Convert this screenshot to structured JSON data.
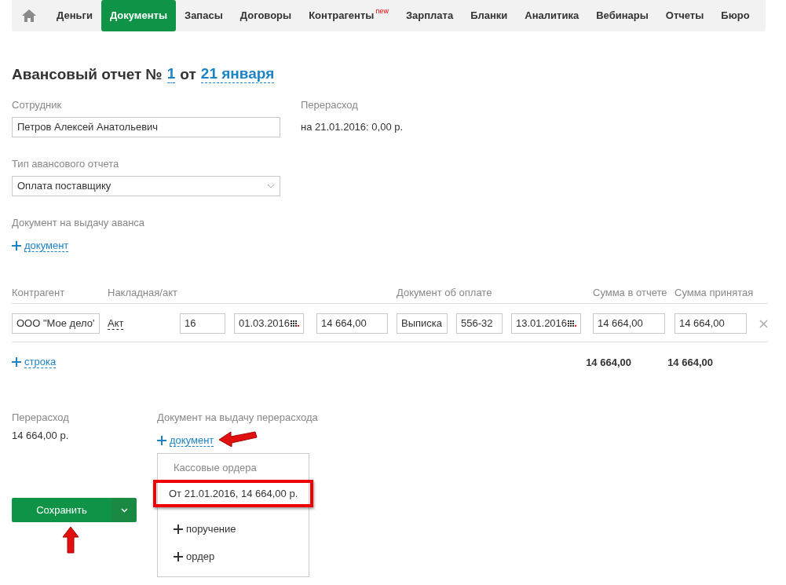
{
  "nav": {
    "items": [
      {
        "label": "Деньги",
        "selected": false
      },
      {
        "label": "Документы",
        "selected": true
      },
      {
        "label": "Запасы",
        "selected": false
      },
      {
        "label": "Договоры",
        "selected": false
      },
      {
        "label": "Контрагенты",
        "selected": false,
        "badge": "new"
      },
      {
        "label": "Зарплата",
        "selected": false
      },
      {
        "label": "Бланки",
        "selected": false
      },
      {
        "label": "Аналитика",
        "selected": false
      },
      {
        "label": "Вебинары",
        "selected": false
      },
      {
        "label": "Отчеты",
        "selected": false
      },
      {
        "label": "Бюро",
        "selected": false
      }
    ]
  },
  "title": {
    "text": "Авансовый отчет №",
    "number": "1",
    "from": "от",
    "date": "21 января"
  },
  "employee": {
    "label": "Сотрудник",
    "value": "Петров Алексей Анатольевич"
  },
  "overspend_top": {
    "label": "Перерасход",
    "value": "на 21.01.2016: 0,00 р."
  },
  "report_type": {
    "label": "Тип авансового отчета",
    "value": "Оплата поставщику"
  },
  "advance_document": {
    "label": "Документ на выдачу аванса",
    "link": "документ"
  },
  "table": {
    "columns": [
      "Контрагент",
      "Накладная/акт",
      "",
      "",
      "",
      "Документ об оплате",
      "",
      "",
      "Сумма в отчете",
      "Сумма принятая"
    ],
    "rows": [
      {
        "cells": [
          {
            "kind": "input",
            "value": "ООО \"Мое дело'"
          },
          {
            "kind": "link",
            "value": "Акт"
          },
          {
            "kind": "input",
            "value": "16"
          },
          {
            "kind": "date",
            "value": "01.03.2016"
          },
          {
            "kind": "input",
            "value": "14 664,00"
          },
          {
            "kind": "input",
            "value": "Выписка"
          },
          {
            "kind": "input",
            "value": "556-32"
          },
          {
            "kind": "date",
            "value": "13.01.2016"
          },
          {
            "kind": "input",
            "value": "14 664,00"
          },
          {
            "kind": "input",
            "value": "14 664,00"
          }
        ]
      }
    ],
    "add_row": "строка",
    "totals": [
      "14 664,00",
      "14 664,00"
    ]
  },
  "overspend": {
    "label": "Перерасход",
    "value": "14 664,00 р."
  },
  "overspend_document": {
    "label": "Документ на выдачу перерасхода",
    "link": "документ",
    "menu": {
      "header": "Кассовые ордера",
      "items": [
        {
          "kind": "option",
          "label": "От 21.01.2016, 14 664,00 р.",
          "highlighted": true
        },
        {
          "kind": "add",
          "label": "поручение",
          "highlighted": false
        },
        {
          "kind": "add",
          "label": "ордер",
          "highlighted": false
        }
      ]
    }
  },
  "save_button": "Сохранить"
}
